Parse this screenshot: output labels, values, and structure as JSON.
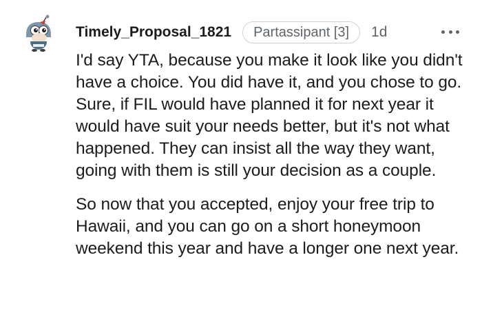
{
  "comment": {
    "author": "Timely_Proposal_1821",
    "flair": "Partassipant [3]",
    "age": "1d",
    "avatar_icon": "snoo-avatar-icon",
    "more_icon": "more-options-icon",
    "paragraphs": [
      "I'd say YTA, because you make it look like you didn't have a choice. You did have it, and you chose to go. Sure, if FIL would have planned it for next year it would have suit your needs better, but it's not what happened. They can insist all the way they want, going with them is still your decision as a couple.",
      "So now that you accepted, enjoy your free trip to Hawaii, and you can go on a short honeymoon weekend this year and have a longer one next year."
    ]
  },
  "colors": {
    "text": "#1c1c1c",
    "meta": "#5f6468",
    "flair_border": "#cfd2d4",
    "background": "#ffffff"
  }
}
